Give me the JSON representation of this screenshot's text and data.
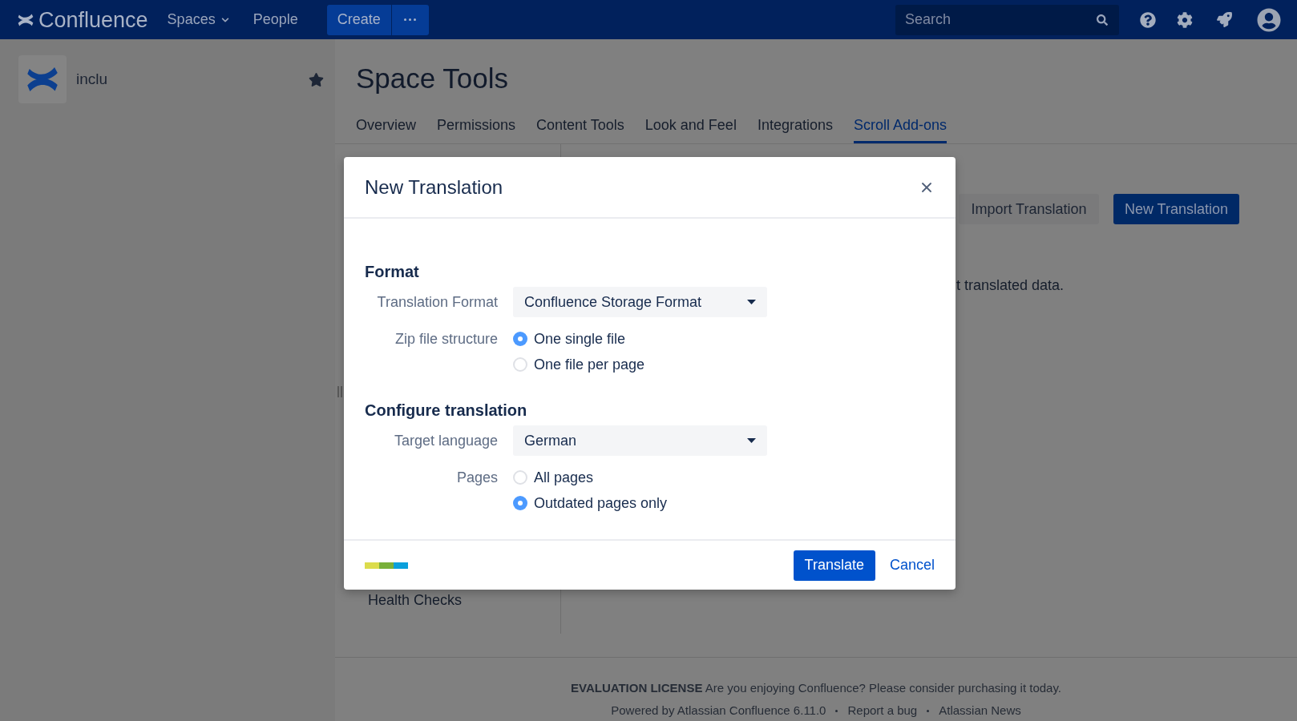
{
  "top_nav": {
    "logo": "Confluence",
    "items": [
      {
        "label": "Spaces",
        "dropdown": true
      },
      {
        "label": "People",
        "dropdown": false
      }
    ],
    "create_button": "Create",
    "search": {
      "placeholder": "Search"
    }
  },
  "sidebar": {
    "space_name": "inclu",
    "starred": true
  },
  "page": {
    "title": "Space Tools",
    "tabs": [
      {
        "label": "Overview",
        "selected": false
      },
      {
        "label": "Permissions",
        "selected": false
      },
      {
        "label": "Content Tools",
        "selected": false
      },
      {
        "label": "Look and Feel",
        "selected": false
      },
      {
        "label": "Integrations",
        "selected": false
      },
      {
        "label": "Scroll Add-ons",
        "selected": true
      }
    ],
    "nav_items": [
      "Health Checks"
    ],
    "buttons": [
      {
        "label": "Import Translation",
        "kind": "secondary"
      },
      {
        "label": "New Translation",
        "kind": "primary"
      }
    ],
    "description": "t translated data."
  },
  "dialog": {
    "title": "New Translation",
    "sections": [
      {
        "heading": "Format",
        "fields": [
          {
            "kind": "select",
            "label": "Translation Format",
            "value": "Confluence Storage Format"
          },
          {
            "kind": "radio",
            "label": "Zip file structure",
            "options": [
              {
                "label": "One single file",
                "selected": true
              },
              {
                "label": "One file per page",
                "selected": false
              }
            ]
          }
        ]
      },
      {
        "heading": "Configure translation",
        "fields": [
          {
            "kind": "select",
            "label": "Target language",
            "value": "German"
          },
          {
            "kind": "radio",
            "label": "Pages",
            "options": [
              {
                "label": "All pages",
                "selected": false
              },
              {
                "label": "Outdated pages only",
                "selected": true
              }
            ]
          }
        ]
      }
    ],
    "primary_button": "Translate",
    "cancel_link": "Cancel"
  },
  "footer": {
    "license": "**EVALUATION LICENSE** Are you enjoying Confluence? Please consider purchasing it today.",
    "links": [
      "Powered by Atlassian Confluence 6.11.0",
      "Report a bug",
      "Atlassian News"
    ]
  }
}
